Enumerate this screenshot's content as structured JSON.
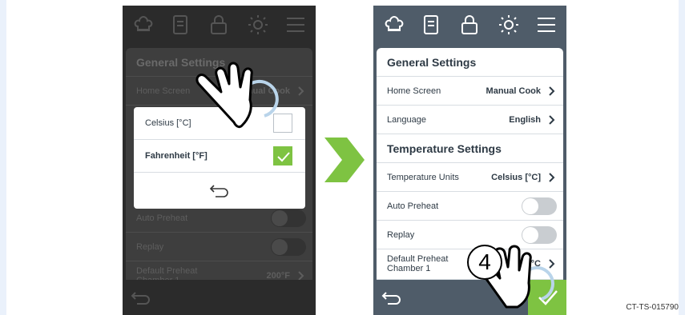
{
  "icons": [
    "chef-hat-icon",
    "recipe-book-icon",
    "lock-icon",
    "brightness-icon",
    "menu-icon"
  ],
  "colors": {
    "header": "#4f5c69",
    "accent_green": "#7ec342",
    "panel": "#ffffff",
    "text": "#2e3a45"
  },
  "left_screen": {
    "section_title": "General Settings",
    "rows": [
      {
        "label": "Home Screen",
        "value": "Manual Cook"
      },
      {
        "label": "Auto Preheat"
      },
      {
        "label": "Replay"
      },
      {
        "label": "Default Preheat Chamber 1",
        "value": "200°F"
      }
    ],
    "dialog": {
      "options": [
        {
          "label": "Celsius [°C]",
          "checked": false
        },
        {
          "label": "Fahrenheit [°F]",
          "checked": true
        }
      ]
    }
  },
  "right_screen": {
    "general_title": "General Settings",
    "home_screen": {
      "label": "Home Screen",
      "value": "Manual Cook"
    },
    "language": {
      "label": "Language",
      "value": "English"
    },
    "temperature_title": "Temperature Settings",
    "temperature_units": {
      "label": "Temperature Units",
      "value": "Celsius [°C]"
    },
    "auto_preheat": {
      "label": "Auto Preheat",
      "on": false
    },
    "replay": {
      "label": "Replay",
      "on": false
    },
    "default_preheat": {
      "label": "Default Preheat Chamber 1",
      "value": "93°C"
    }
  },
  "step_number": "4",
  "reference_code": "CT-TS-015790"
}
